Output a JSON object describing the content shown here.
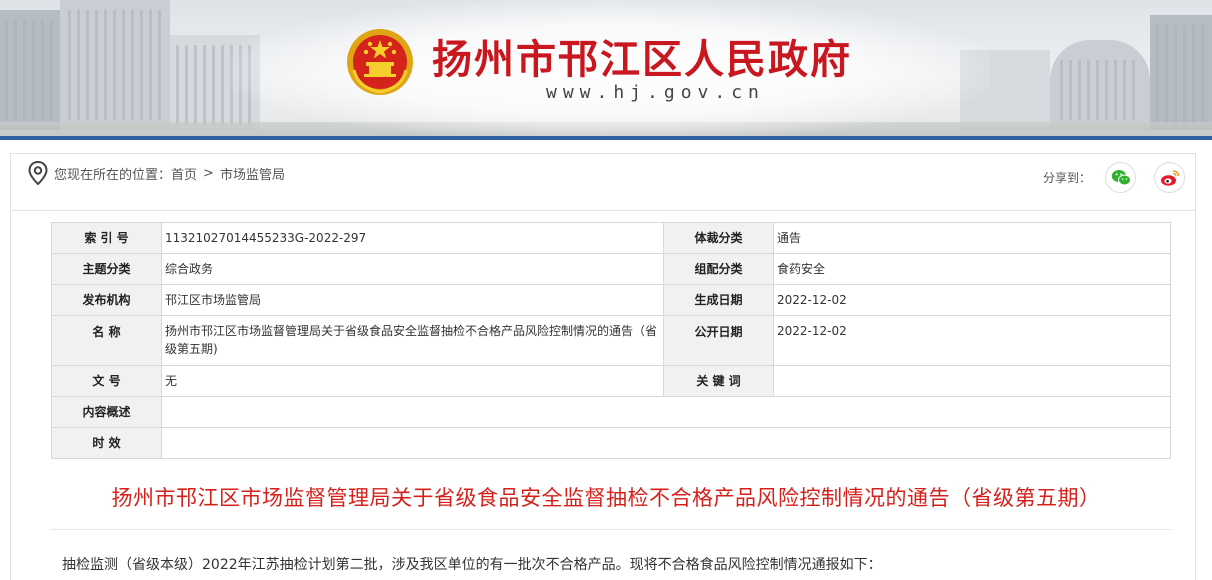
{
  "header": {
    "site_title": "扬州市邗江区人民政府",
    "site_url": "www.hj.gov.cn"
  },
  "breadcrumb": {
    "prefix": "您现在所在的位置：",
    "items": [
      "首页",
      "市场监管局"
    ],
    "separator": ">"
  },
  "share": {
    "label": "分享到：",
    "icons": [
      "wechat-icon",
      "weibo-icon"
    ],
    "colors": {
      "wechat": "#2fb22e",
      "weibo": "#e6162d"
    }
  },
  "meta": {
    "rows": [
      {
        "k1": "索 引 号",
        "v1": "11321027014455233G-2022-297",
        "k2": "体裁分类",
        "v2": "通告"
      },
      {
        "k1": "主题分类",
        "v1": "综合政务",
        "k2": "组配分类",
        "v2": "食药安全"
      },
      {
        "k1": "发布机构",
        "v1": "邗江区市场监管局",
        "k2": "生成日期",
        "v2": "2022-12-02"
      },
      {
        "k1": "名 称",
        "v1": "扬州市邗江区市场监督管理局关于省级食品安全监督抽检不合格产品风险控制情况的通告（省级第五期)",
        "k2": "公开日期",
        "v2": "2022-12-02"
      },
      {
        "k1": "文 号",
        "v1": "无",
        "k2": "关 键 词",
        "v2": ""
      },
      {
        "k1": "内容概述",
        "v1": ""
      },
      {
        "k1": "时 效",
        "v1": ""
      }
    ]
  },
  "article": {
    "title": "扬州市邗江区市场监督管理局关于省级食品安全监督抽检不合格产品风险控制情况的通告（省级第五期）",
    "lead": "抽检监测（省级本级）2022年江苏抽检计划第二批，涉及我区单位的有一批次不合格产品。现将不合格食品风险控制情况通报如下：",
    "title_color": "#d5201b"
  }
}
